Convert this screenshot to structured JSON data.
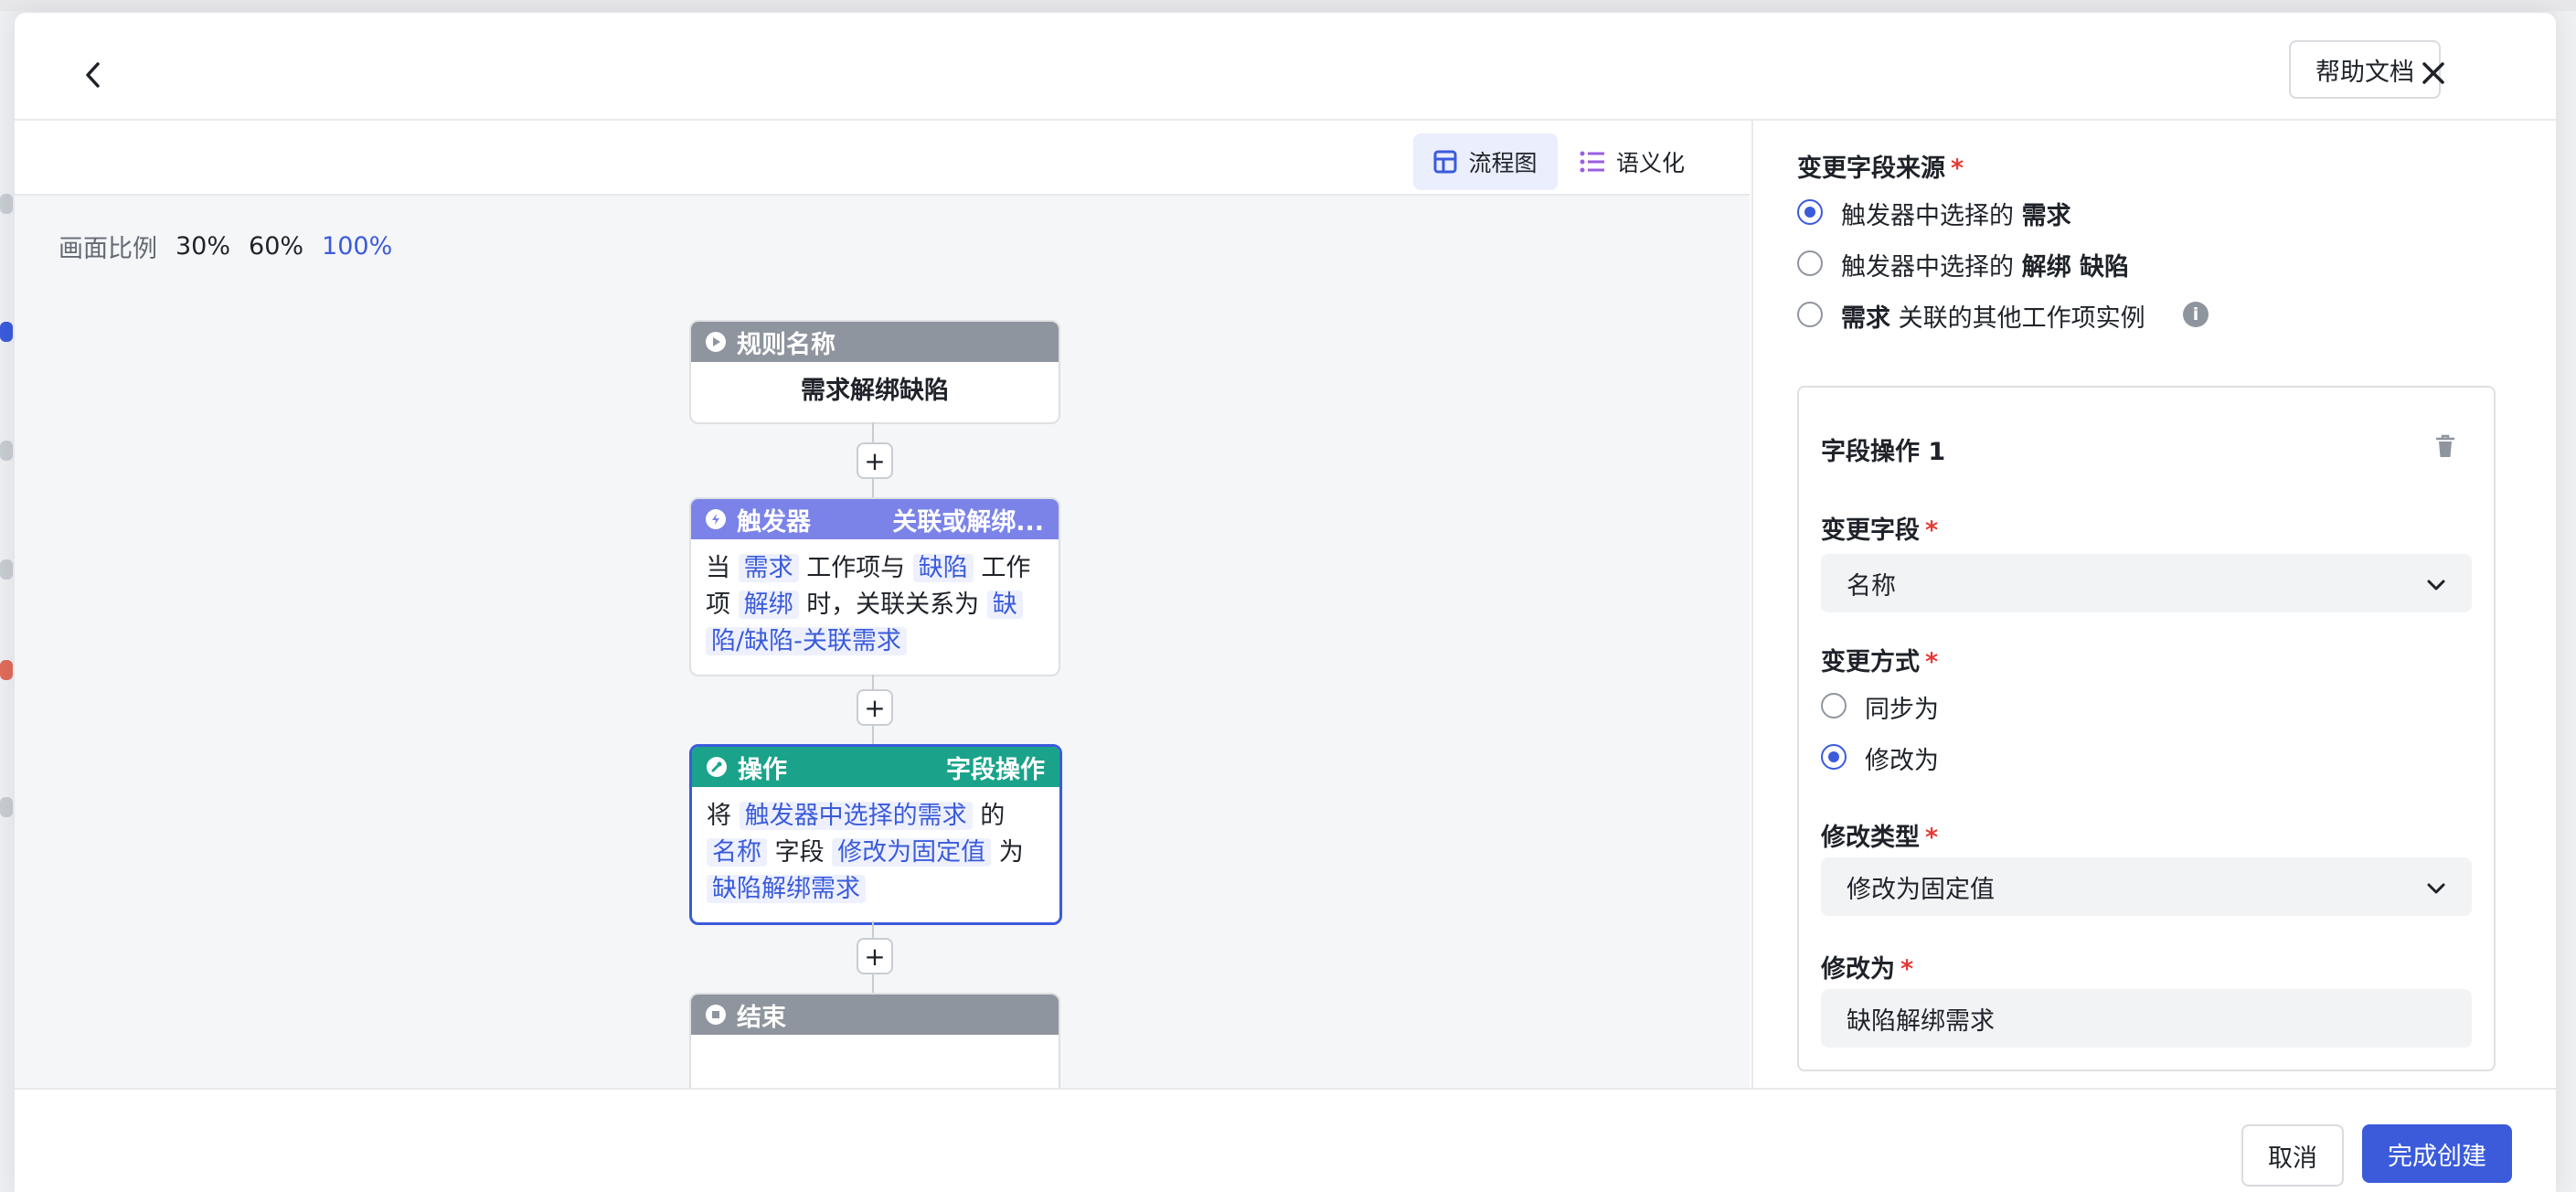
{
  "header": {
    "help_label": "帮助文档"
  },
  "toolbar": {
    "flow_label": "流程图",
    "semantic_label": "语义化"
  },
  "zoom": {
    "label": "画面比例",
    "options": [
      "30%",
      "60%",
      "100%"
    ],
    "selected": "100%"
  },
  "nodes": {
    "rule": {
      "title": "规则名称",
      "body": "需求解绑缺陷"
    },
    "trigger": {
      "title": "触发器",
      "subtitle": "关联或解绑...",
      "t1": "当",
      "tag1": "需求",
      "t2": "工作项与",
      "tag2": "缺陷",
      "t3": "工作",
      "t4": "项",
      "tag3": "解绑",
      "t5": "时，关联关系为",
      "tag4a": "缺",
      "tag4b": "陷/缺陷-关联需求"
    },
    "action": {
      "title": "操作",
      "subtitle": "字段操作",
      "t1": "将",
      "tag1": "触发器中选择的需求",
      "t2": "的",
      "tag2": "名称",
      "t3": "字段",
      "tag3": "修改为固定值",
      "t4": "为",
      "tag4": "缺陷解绑需求"
    },
    "end": {
      "title": "结束"
    }
  },
  "panel": {
    "source_label": "变更字段来源",
    "source_options": [
      {
        "pre": "触发器中选择的 ",
        "bold": "需求",
        "selected": true
      },
      {
        "pre": "触发器中选择的 ",
        "bold": "解绑 缺陷",
        "selected": false
      },
      {
        "pre": "",
        "bold": "需求",
        "post": " 关联的其他工作项实例",
        "selected": false
      }
    ],
    "op_title": "字段操作 1",
    "field_label": "变更字段",
    "field_value": "名称",
    "method_label": "变更方式",
    "method_options": [
      {
        "label": "同步为",
        "selected": false
      },
      {
        "label": "修改为",
        "selected": true
      }
    ],
    "modtype_label": "修改类型",
    "modtype_value": "修改为固定值",
    "modto_label": "修改为",
    "modto_value": "缺陷解绑需求"
  },
  "footer": {
    "cancel_label": "取消",
    "submit_label": "完成创建"
  },
  "colors": {
    "primary": "#3b5bdb",
    "trigger_header": "#7b83e8",
    "action_header": "#1aa38a",
    "rule_header": "#8f959e"
  }
}
